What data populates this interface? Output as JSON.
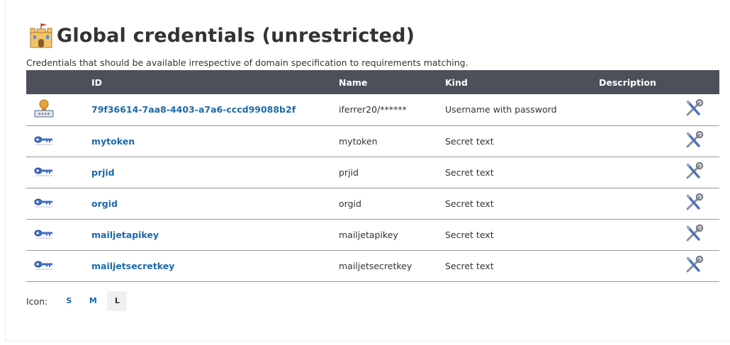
{
  "page": {
    "title": "Global credentials (unrestricted)",
    "title_icon": "castle-icon",
    "description": "Credentials that should be available irrespective of domain specification to requirements matching."
  },
  "table": {
    "headers": {
      "id": "ID",
      "name": "Name",
      "kind": "Kind",
      "description": "Description"
    },
    "rows": [
      {
        "icon": "certificate-password-icon",
        "id": "79f36614-7aa8-4403-a7a6-cccd99088b2f",
        "name": "iferrer20/******",
        "kind": "Username with password",
        "description": ""
      },
      {
        "icon": "key-icon",
        "id": "mytoken",
        "name": "mytoken",
        "kind": "Secret text",
        "description": ""
      },
      {
        "icon": "key-icon",
        "id": "prjid",
        "name": "prjid",
        "kind": "Secret text",
        "description": ""
      },
      {
        "icon": "key-icon",
        "id": "orgid",
        "name": "orgid",
        "kind": "Secret text",
        "description": ""
      },
      {
        "icon": "key-icon",
        "id": "mailjetapikey",
        "name": "mailjetapikey",
        "kind": "Secret text",
        "description": ""
      },
      {
        "icon": "key-icon",
        "id": "mailjetsecretkey",
        "name": "mailjetsecretkey",
        "kind": "Secret text",
        "description": ""
      }
    ],
    "action_icon": "configure-tools-icon"
  },
  "icon_size": {
    "label": "Icon:",
    "options": [
      "S",
      "M",
      "L"
    ],
    "selected": "L"
  },
  "colors": {
    "header_bg": "#4b5059",
    "link": "#1c6aa8",
    "row_border": "#999999"
  }
}
